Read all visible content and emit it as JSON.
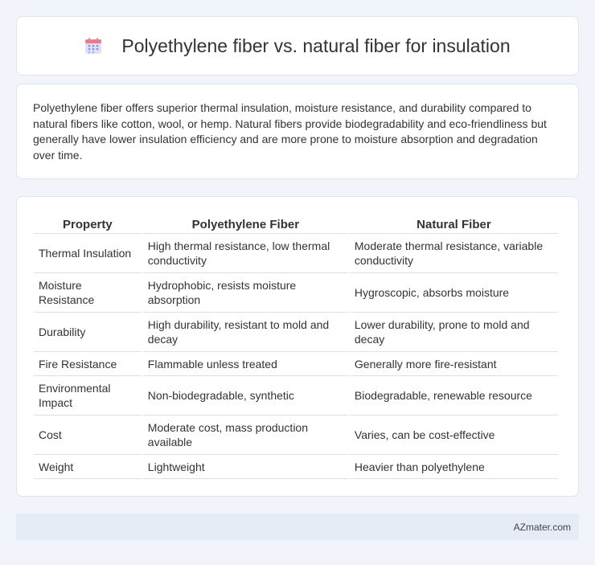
{
  "header": {
    "icon": "calendar-icon",
    "title": "Polyethylene fiber vs. natural fiber for insulation"
  },
  "summary": {
    "text": "Polyethylene fiber offers superior thermal insulation, moisture resistance, and durability compared to natural fibers like cotton, wool, or hemp. Natural fibers provide biodegradability and eco-friendliness but generally have lower insulation efficiency and are more prone to moisture absorption and degradation over time."
  },
  "table": {
    "headers": [
      "Property",
      "Polyethylene Fiber",
      "Natural Fiber"
    ],
    "rows": [
      [
        "Thermal Insulation",
        "High thermal resistance, low thermal conductivity",
        "Moderate thermal resistance, variable conductivity"
      ],
      [
        "Moisture Resistance",
        "Hydrophobic, resists moisture absorption",
        "Hygroscopic, absorbs moisture"
      ],
      [
        "Durability",
        "High durability, resistant to mold and decay",
        "Lower durability, prone to mold and decay"
      ],
      [
        "Fire Resistance",
        "Flammable unless treated",
        "Generally more fire-resistant"
      ],
      [
        "Environmental Impact",
        "Non-biodegradable, synthetic",
        "Biodegradable, renewable resource"
      ],
      [
        "Cost",
        "Moderate cost, mass production available",
        "Varies, can be cost-effective"
      ],
      [
        "Weight",
        "Lightweight",
        "Heavier than polyethylene"
      ]
    ]
  },
  "footer": {
    "site": "AZmater.com"
  },
  "colors": {
    "background": "#f1f4fa",
    "card": "#ffffff",
    "footer": "#e6ecf5",
    "icon_top": "#f07a86",
    "icon_body": "#dfe2f7",
    "icon_dots": "#7f8ee8"
  }
}
